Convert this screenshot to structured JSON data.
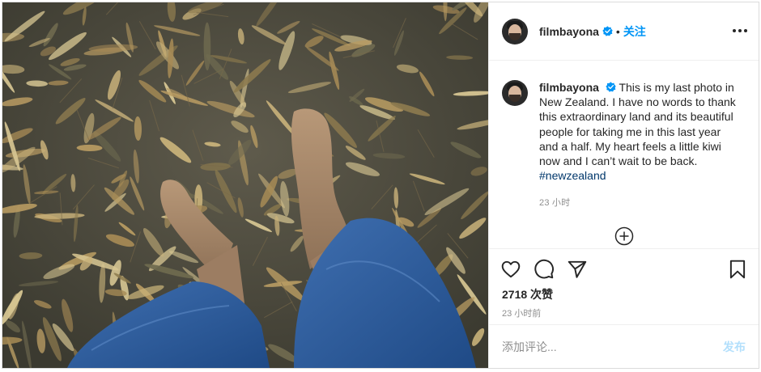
{
  "post": {
    "author": {
      "username": "filmbayona",
      "verified": true,
      "follow_label": "关注",
      "separator": "•"
    },
    "caption": {
      "text": "This is my last photo in New Zealand. I have no words to thank this extraordinary land and its beautiful people for taking me in this last year and a half. My heart feels a little kiwi now and I can’t wait to be back.",
      "hashtag": "#newzealand",
      "time": "23 小时"
    },
    "likes": "2718 次赞",
    "time_ago": "23 小时前",
    "comment": {
      "placeholder": "添加评论...",
      "post_label": "发布"
    },
    "icons": {
      "more": "more-options-icon",
      "like": "heart-icon",
      "comment": "comment-icon",
      "share": "paper-plane-icon",
      "save": "bookmark-icon",
      "load_more": "plus-circle-icon",
      "verified": "verified-badge-icon"
    },
    "colors": {
      "accent": "#0095f6",
      "hashtag": "#00376b",
      "muted": "#8e8e8e",
      "post_disabled": "#b2dffc"
    }
  }
}
